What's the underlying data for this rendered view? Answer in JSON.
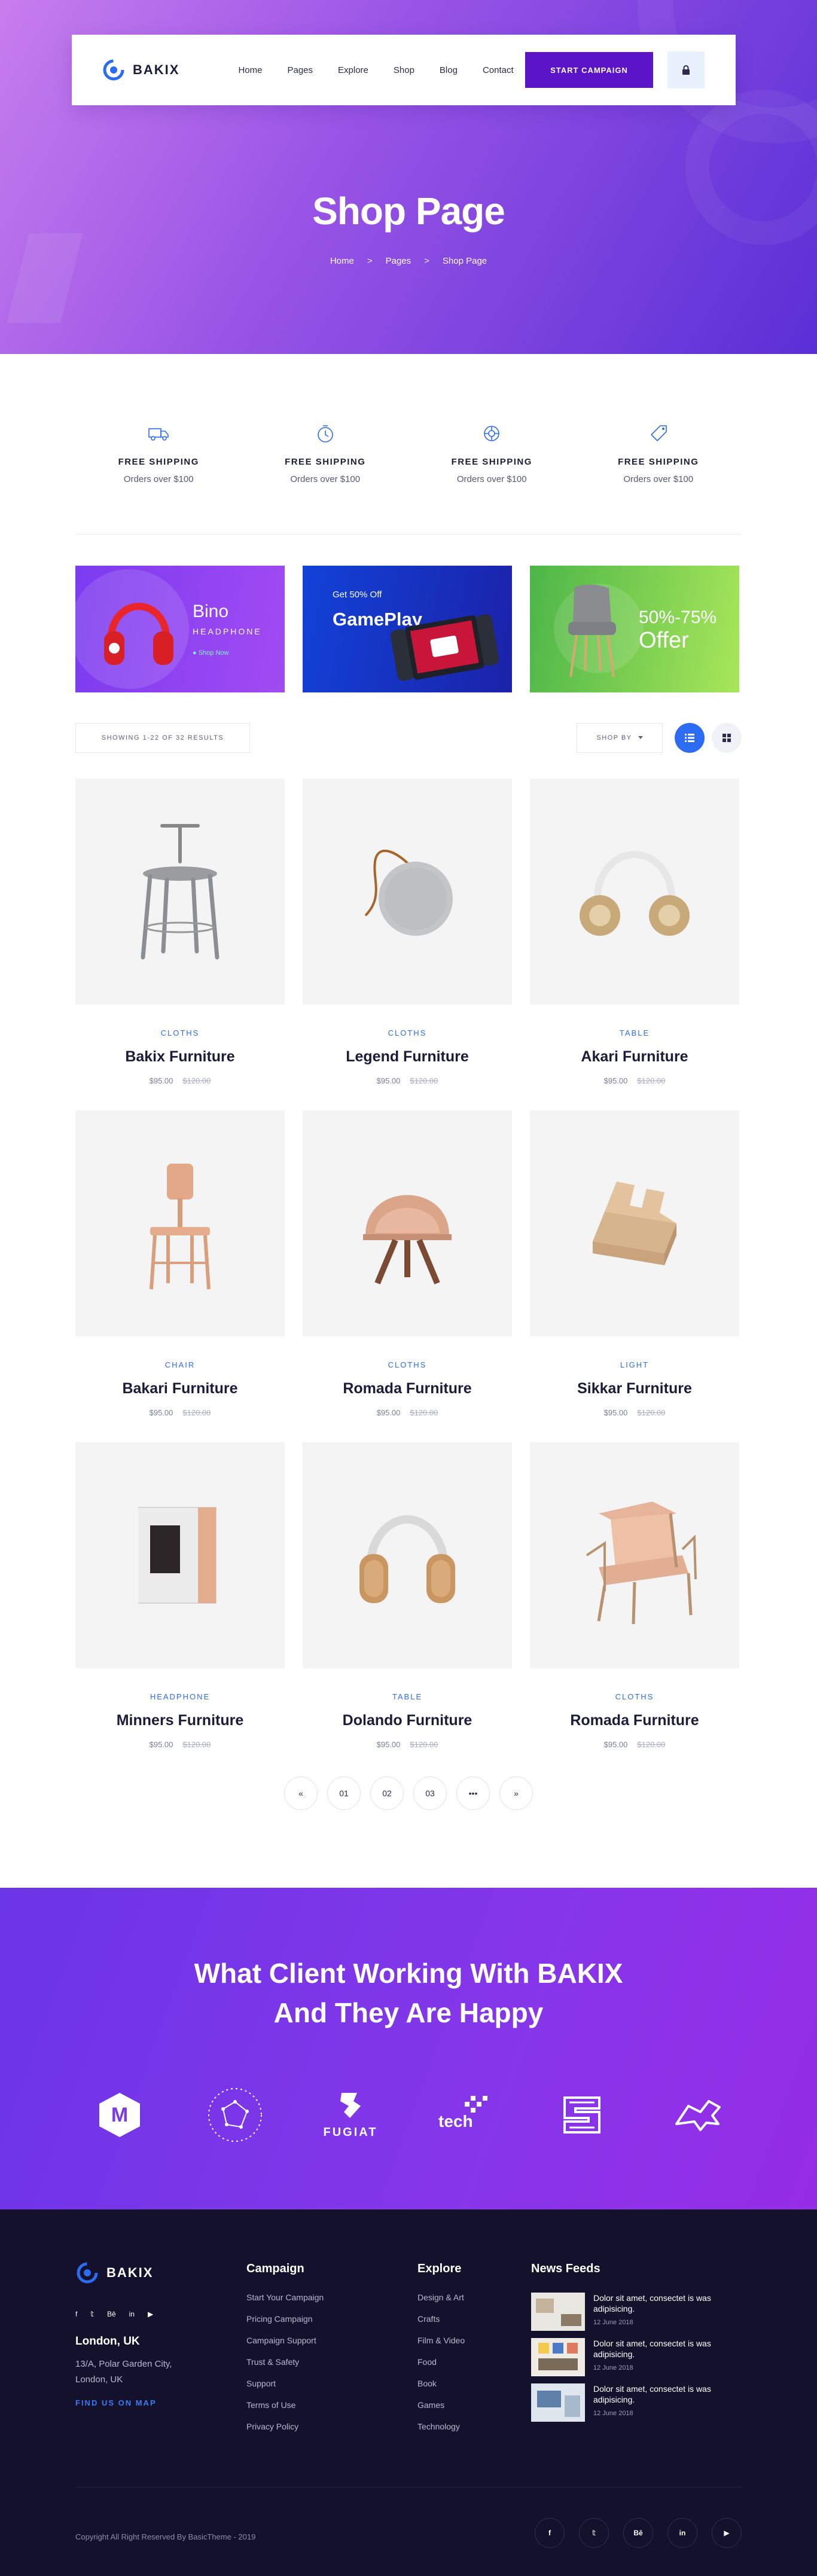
{
  "nav": {
    "brand": "BAKIX",
    "items": [
      "Home",
      "Pages",
      "Explore",
      "Shop",
      "Blog",
      "Contact"
    ],
    "cta": "START CAMPAIGN"
  },
  "hero": {
    "title": "Shop Page",
    "breadcrumb": [
      "Home",
      "Pages",
      "Shop Page"
    ],
    "separator": ">"
  },
  "features": [
    {
      "icon": "truck-icon",
      "title": "FREE SHIPPING",
      "sub": "Orders over $100"
    },
    {
      "icon": "timer-icon",
      "title": "FREE SHIPPING",
      "sub": "Orders over $100"
    },
    {
      "icon": "support-icon",
      "title": "FREE SHIPPING",
      "sub": "Orders over $100"
    },
    {
      "icon": "tag-icon",
      "title": "FREE SHIPPING",
      "sub": "Orders over $100"
    }
  ],
  "promos": {
    "p1": {
      "name": "Bino",
      "sub": "HEADPHONE",
      "link": "Shop Now"
    },
    "p2": {
      "small": "Get 50% Off",
      "name": "GamePlay"
    },
    "p3": {
      "name": "50%-75%",
      "sub": "Offer"
    }
  },
  "toolbar": {
    "results": "SHOWING 1-22 OF 32 RESULTS",
    "sort": "SHOP BY"
  },
  "products": [
    {
      "category": "CLOTHS",
      "name": "Bakix Furniture",
      "price": "$95.00",
      "old": "$120.00",
      "img": "chair-stool"
    },
    {
      "category": "CLOTHS",
      "name": "Legend Furniture",
      "price": "$95.00",
      "old": "$120.00",
      "img": "speaker"
    },
    {
      "category": "TABLE",
      "name": "Akari Furniture",
      "price": "$95.00",
      "old": "$120.00",
      "img": "headphones-white"
    },
    {
      "category": "CHAIR",
      "name": "Bakari Furniture",
      "price": "$95.00",
      "old": "$120.00",
      "img": "wood-chair"
    },
    {
      "category": "CLOTHS",
      "name": "Romada Furniture",
      "price": "$95.00",
      "old": "$120.00",
      "img": "shell-chair"
    },
    {
      "category": "LIGHT",
      "name": "Sikkar Furniture",
      "price": "$95.00",
      "old": "$120.00",
      "img": "wood-stand"
    },
    {
      "category": "HEADPHONE",
      "name": "Minners Furniture",
      "price": "$95.00",
      "old": "$120.00",
      "img": "lamp-block"
    },
    {
      "category": "TABLE",
      "name": "Dolando Furniture",
      "price": "$95.00",
      "old": "$120.00",
      "img": "headphones-tan"
    },
    {
      "category": "CLOTHS",
      "name": "Romada Furniture",
      "price": "$95.00",
      "old": "$120.00",
      "img": "armchair"
    }
  ],
  "pagination": [
    "«",
    "01",
    "02",
    "03",
    "•••",
    "»"
  ],
  "clients": {
    "title_line1": "What Client Working With BAKIX",
    "title_line2": "And They Are Happy",
    "logos": [
      "M",
      "",
      "FUGIAT",
      "tech",
      "",
      ""
    ]
  },
  "footer": {
    "brand": "BAKIX",
    "social": [
      "f",
      "𝕥",
      "Bē",
      "in",
      "▶"
    ],
    "city": "London, UK",
    "address": "13/A, Polar Garden City, London, UK",
    "map": "FIND US ON MAP",
    "campaign": {
      "title": "Campaign",
      "links": [
        "Start Your Campaign",
        "Pricing Campaign",
        "Campaign Support",
        "Trust & Safety",
        "Support",
        "Terms of Use",
        "Privacy Policy"
      ]
    },
    "explore": {
      "title": "Explore",
      "links": [
        "Design & Art",
        "Crafts",
        "Film & Video",
        "Food",
        "Book",
        "Games",
        "Technology"
      ]
    },
    "news": {
      "title": "News Feeds",
      "items": [
        {
          "text": "Dolor sit amet, consectet is was adipisicing.",
          "date": "12 June 2018"
        },
        {
          "text": "Dolor sit amet, consectet is was adipisicing.",
          "date": "12 June 2018"
        },
        {
          "text": "Dolor sit amet, consectet is was adipisicing.",
          "date": "12 June 2018"
        }
      ]
    },
    "copyright": "Copyright All Right Reserved By BasicTheme - 2019",
    "bottom_social": [
      "f",
      "𝕥",
      "Bē",
      "in",
      "▶"
    ]
  },
  "colors": {
    "accent": "#2c6cf2",
    "brand_purple": "#5b14c8",
    "footer_bg": "#14112c"
  }
}
